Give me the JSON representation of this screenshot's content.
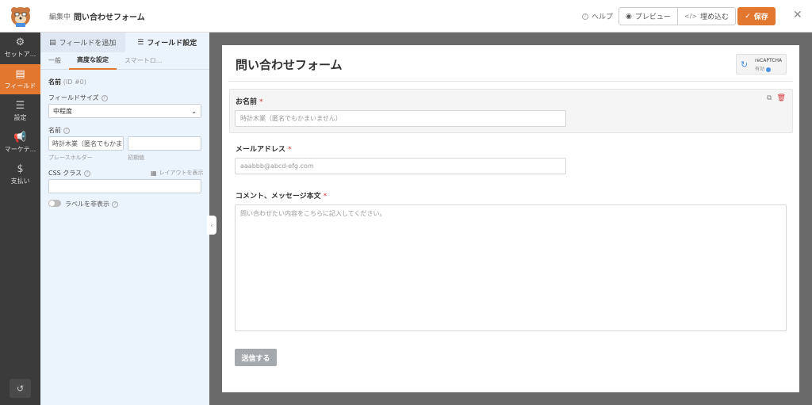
{
  "topbar": {
    "editing_label": "編集中",
    "form_name": "問い合わせフォーム",
    "help_label": "ヘルプ",
    "preview_label": "プレビュー",
    "embed_label": "埋め込む",
    "save_label": "保存"
  },
  "rail": {
    "items": [
      {
        "label": "セットア...",
        "icon": "gear-icon"
      },
      {
        "label": "フィールド",
        "icon": "fields-icon"
      },
      {
        "label": "設定",
        "icon": "sliders-icon"
      },
      {
        "label": "マーケテ...",
        "icon": "megaphone-icon"
      },
      {
        "label": "支払い",
        "icon": "dollar-icon"
      }
    ],
    "active_index": 1
  },
  "panel": {
    "tabs": [
      {
        "label": "フィールドを追加"
      },
      {
        "label": "フィールド設定"
      }
    ],
    "subtabs": [
      {
        "label": "一般"
      },
      {
        "label": "高度な設定"
      },
      {
        "label": "スマートロ..."
      }
    ],
    "section_title": "名前",
    "section_id": "(ID #0)",
    "field_size_label": "フィールドサイズ",
    "field_size_value": "中程度",
    "name_label": "名前",
    "placeholder_value": "時計木業（匿名でもかま",
    "placeholder_hint": "プレースホルダー",
    "default_value": "",
    "default_hint": "初期値",
    "css_class_label": "CSS クラス",
    "layout_label": "レイアウトを表示",
    "css_class_value": "",
    "hide_label_text": "ラベルを非表示"
  },
  "form": {
    "title": "問い合わせフォーム",
    "recaptcha_title": "reCAPTCHA",
    "recaptcha_status": "有効",
    "fields": [
      {
        "label": "お名前",
        "required": "*",
        "placeholder": "時計木業（匿名でもかまいません）"
      },
      {
        "label": "メールアドレス",
        "required": "*",
        "placeholder": "aaabbb@abcd-efg.com"
      },
      {
        "label": "コメント、メッセージ本文",
        "required": "*",
        "placeholder": "問い合わせたい内容をこちらに記入してください。"
      }
    ],
    "submit_label": "送信する"
  },
  "colors": {
    "accent": "#e27730",
    "rail_bg": "#3b3b3b",
    "panel_bg": "#ebf3fc",
    "canvas_bg": "#6a6a6a",
    "required": "#d63638"
  }
}
